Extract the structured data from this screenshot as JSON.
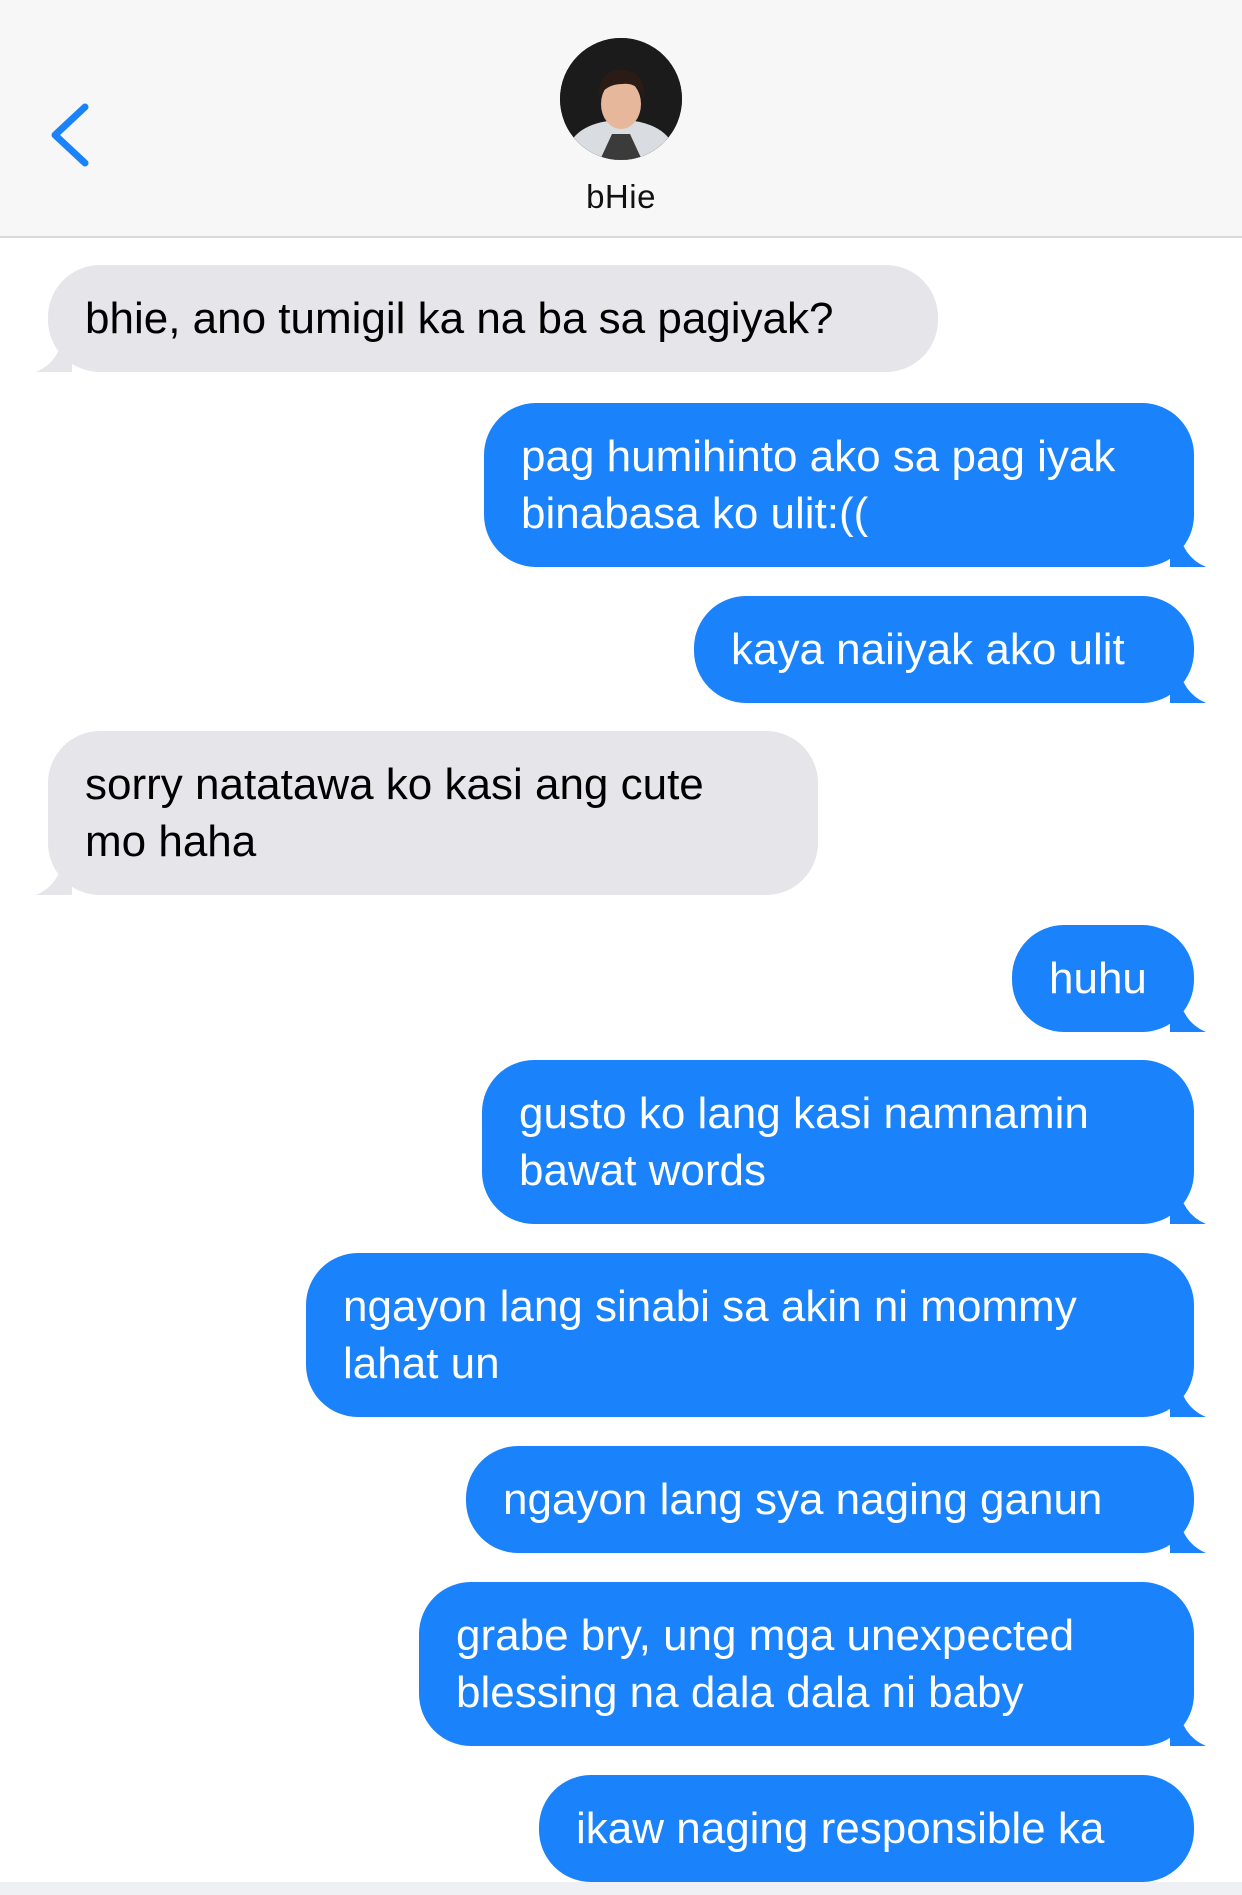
{
  "header": {
    "contact_name": "bHie",
    "back_icon": "chevron-left-icon",
    "accent_color": "#1a82fb"
  },
  "messages": [
    {
      "sender": "them",
      "text": "bhie, ano tumigil ka na ba sa pagiyak?"
    },
    {
      "sender": "me",
      "text": "pag humihinto ako sa pag iyak\nbinabasa ko ulit:(("
    },
    {
      "sender": "me",
      "text": "kaya naiiyak ako ulit"
    },
    {
      "sender": "them",
      "text": "sorry natatawa ko kasi ang cute\nmo haha"
    },
    {
      "sender": "me",
      "text": "huhu"
    },
    {
      "sender": "me",
      "text": "gusto ko lang kasi namnamin\nbawat words"
    },
    {
      "sender": "me",
      "text": "ngayon lang sinabi sa akin ni mommy\nlahat un"
    },
    {
      "sender": "me",
      "text": "ngayon lang sya naging ganun"
    },
    {
      "sender": "me",
      "text": "grabe bry, ung mga unexpected\nblessing na dala dala ni baby"
    },
    {
      "sender": "me",
      "text": "ikaw naging responsible ka"
    }
  ]
}
